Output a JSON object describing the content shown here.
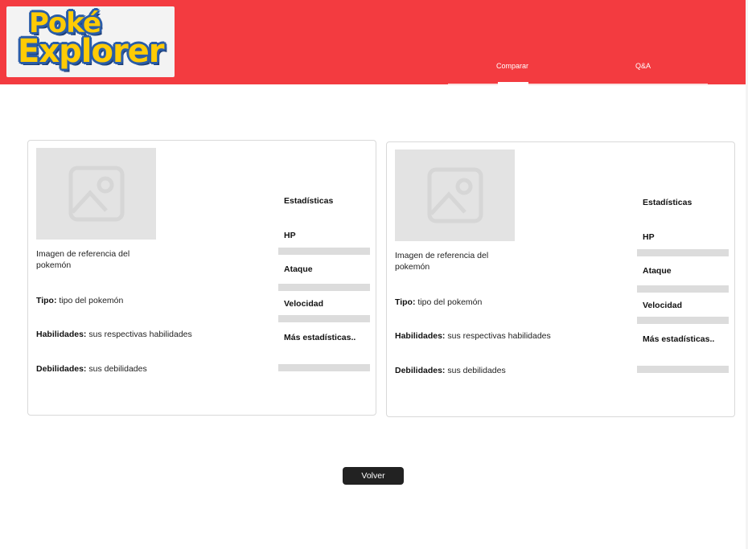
{
  "header": {
    "logo_line1": "Poké",
    "logo_line2": "Explorer",
    "nav": [
      {
        "label": "Comparar",
        "active": true
      },
      {
        "label": "Q&A",
        "active": false
      }
    ],
    "color": "#f33b40"
  },
  "cards": [
    {
      "image_caption": "Imagen de referencia del pokemón",
      "type_label": "Tipo:",
      "type_value": " tipo del pokemón",
      "abilities_label": "Habilidades:",
      "abilities_value": " sus respectivas habilidades",
      "weaknesses_label": "Debilidades:",
      "weaknesses_value": " sus debilidades",
      "stats_title": "Estadísticas",
      "stats": [
        "HP",
        "Ataque",
        "Velocidad",
        "Más estadísticas.."
      ]
    },
    {
      "image_caption": "Imagen de referencia del pokemón",
      "type_label": "Tipo:",
      "type_value": " tipo del pokemón",
      "abilities_label": "Habilidades:",
      "abilities_value": " sus respectivas habilidades",
      "weaknesses_label": "Debilidades:",
      "weaknesses_value": " sus debilidades",
      "stats_title": "Estadísticas",
      "stats": [
        "HP",
        "Ataque",
        "Velocidad",
        "Más estadísticas.."
      ]
    }
  ],
  "back_button": "Volver"
}
